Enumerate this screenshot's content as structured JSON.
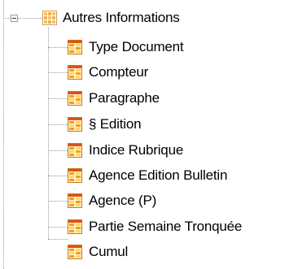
{
  "tree": {
    "root": {
      "label": "Autres Informations",
      "icon": "table-group-icon",
      "expanded": true
    },
    "children": [
      {
        "label": "Type Document",
        "icon": "table-field-icon"
      },
      {
        "label": "Compteur",
        "icon": "table-field-icon"
      },
      {
        "label": "Paragraphe",
        "icon": "table-field-icon"
      },
      {
        "label": "§ Edition",
        "icon": "table-field-icon"
      },
      {
        "label": "Indice Rubrique",
        "icon": "table-field-icon"
      },
      {
        "label": "Agence Edition Bulletin",
        "icon": "table-field-icon"
      },
      {
        "label": "Agence (P)",
        "icon": "table-field-icon"
      },
      {
        "label": "Partie Semaine Tronquée",
        "icon": "table-field-icon"
      },
      {
        "label": "Cumul",
        "icon": "table-field-icon"
      }
    ],
    "colors": {
      "leaf_icon_orange": "#f0a020",
      "leaf_icon_red": "#e05010",
      "leaf_icon_yellow": "#ffd860",
      "guide_line": "#9a9a9a"
    }
  }
}
